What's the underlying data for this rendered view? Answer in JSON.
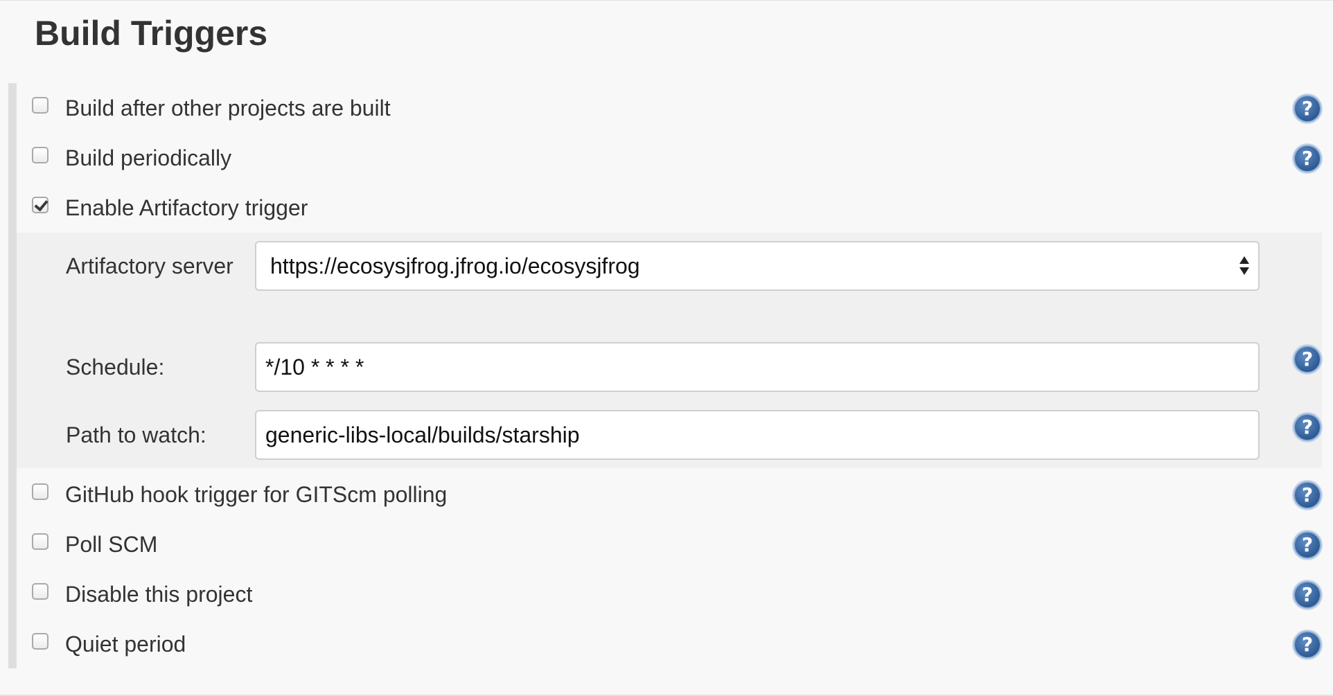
{
  "section": {
    "title": "Build Triggers"
  },
  "triggers": [
    {
      "label": "Build after other projects are built",
      "checked": false,
      "has_help": true
    },
    {
      "label": "Build periodically",
      "checked": false,
      "has_help": true
    },
    {
      "label": "Enable Artifactory trigger",
      "checked": true,
      "has_help": false
    },
    {
      "label": "GitHub hook trigger for GITScm polling",
      "checked": false,
      "has_help": true
    },
    {
      "label": "Poll SCM",
      "checked": false,
      "has_help": true
    },
    {
      "label": "Disable this project",
      "checked": false,
      "has_help": true
    },
    {
      "label": "Quiet period",
      "checked": false,
      "has_help": true
    }
  ],
  "artifactory": {
    "server_label": "Artifactory server",
    "server_value": "https://ecosysjfrog.jfrog.io/ecosysjfrog",
    "schedule_label": "Schedule:",
    "schedule_value": "*/10 * * * *",
    "path_label": "Path to watch:",
    "path_value": "generic-libs-local/builds/starship"
  },
  "icons": {
    "help": "help-icon",
    "checkbox": "checkbox-icon",
    "select_arrows": "select-arrows-icon"
  },
  "colors": {
    "background": "#f8f8f8",
    "panel": "#f0f0f0",
    "help_blue": "#2e5b93",
    "text": "#333333"
  }
}
